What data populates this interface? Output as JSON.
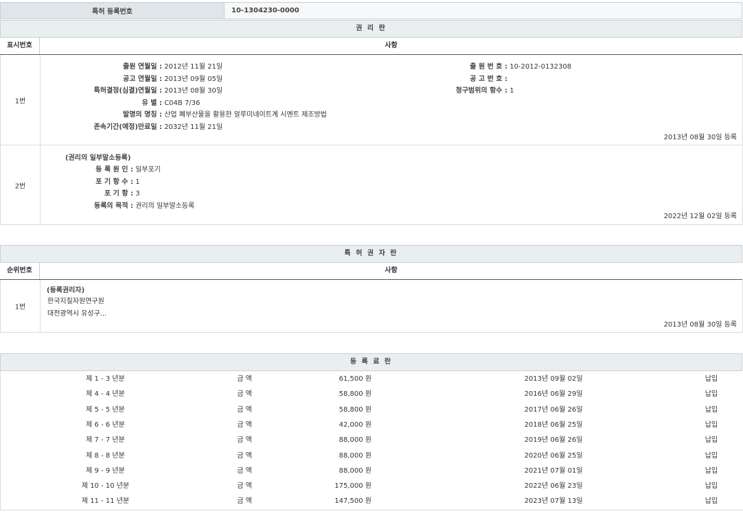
{
  "header": {
    "label": "특허 등록번호",
    "value": "10-1304230-0000"
  },
  "rights": {
    "title": "권 리 란",
    "col_num": "표시번호",
    "col_matter": "사항",
    "row1": {
      "num": "1번",
      "fields": [
        {
          "k": "출원 연월일 :",
          "v": "2012년 11월 21일"
        },
        {
          "k": "공고 연월일 :",
          "v": "2013년 09월 05일"
        },
        {
          "k": "특허결정(심결)연월일 :",
          "v": "2013년 08월 30일"
        },
        {
          "k": "유 별 :",
          "v": "C04B 7/36"
        },
        {
          "k": "발명의 명칭 :",
          "v": "산업 폐부산물을 활용한 알루미네이트계 시멘트 제조방법"
        },
        {
          "k": "존속기간(예정)만료일 :",
          "v": "2032년 11월 21일"
        }
      ],
      "right_fields": [
        {
          "k": "출 원 번 호 :",
          "v": "10-2012-0132308"
        },
        {
          "k": "공 고 번 호 :",
          "v": ""
        },
        {
          "k": "청구범위의 항수 :",
          "v": "1"
        }
      ],
      "reg": "2013년 08월 30일 등록"
    },
    "row2": {
      "num": "2번",
      "heading": "(권리의 일부말소등록)",
      "fields": [
        {
          "k": "등 록 원 인 :",
          "v": "일부포기"
        },
        {
          "k": "포 기 항 수 :",
          "v": "1"
        },
        {
          "k": "포 기 항 :",
          "v": "3"
        },
        {
          "k": "등록의 목적 :",
          "v": "권리의 일부말소등록"
        }
      ],
      "reg": "2022년 12월 02일 등록"
    }
  },
  "holders": {
    "title": "특 허 권 자 란",
    "col_num": "순위번호",
    "col_matter": "사항",
    "row1": {
      "num": "1번",
      "heading": "(등록권리자)",
      "name": "한국지질자원연구원",
      "address": "대전광역시 유성구...",
      "reg": "2013년 08월 30일 등록"
    }
  },
  "fees": {
    "title": "등 록 료 란",
    "rows": [
      {
        "period": "제 1 - 3 년분",
        "label": "금 액",
        "amount": "61,500 원",
        "date": "2013년 09월 02일",
        "status": "납입"
      },
      {
        "period": "제 4 - 4 년분",
        "label": "금 액",
        "amount": "58,800 원",
        "date": "2016년 06월 29일",
        "status": "납입"
      },
      {
        "period": "제 5 - 5 년분",
        "label": "금 액",
        "amount": "58,800 원",
        "date": "2017년 06월 26일",
        "status": "납입"
      },
      {
        "period": "제 6 - 6 년분",
        "label": "금 액",
        "amount": "42,000 원",
        "date": "2018년 06월 25일",
        "status": "납입"
      },
      {
        "period": "제 7 - 7 년분",
        "label": "금 액",
        "amount": "88,000 원",
        "date": "2019년 06월 26일",
        "status": "납입"
      },
      {
        "period": "제 8 - 8 년분",
        "label": "금 액",
        "amount": "88,000 원",
        "date": "2020년 06월 25일",
        "status": "납입"
      },
      {
        "period": "제 9 - 9 년분",
        "label": "금 액",
        "amount": "88,000 원",
        "date": "2021년 07월 01일",
        "status": "납입"
      },
      {
        "period": "제 10 - 10 년분",
        "label": "금 액",
        "amount": "175,000 원",
        "date": "2022년 06월 23일",
        "status": "납입"
      },
      {
        "period": "제 11 - 11 년분",
        "label": "금 액",
        "amount": "147,500 원",
        "date": "2023년 07월 13일",
        "status": "납입"
      }
    ]
  }
}
